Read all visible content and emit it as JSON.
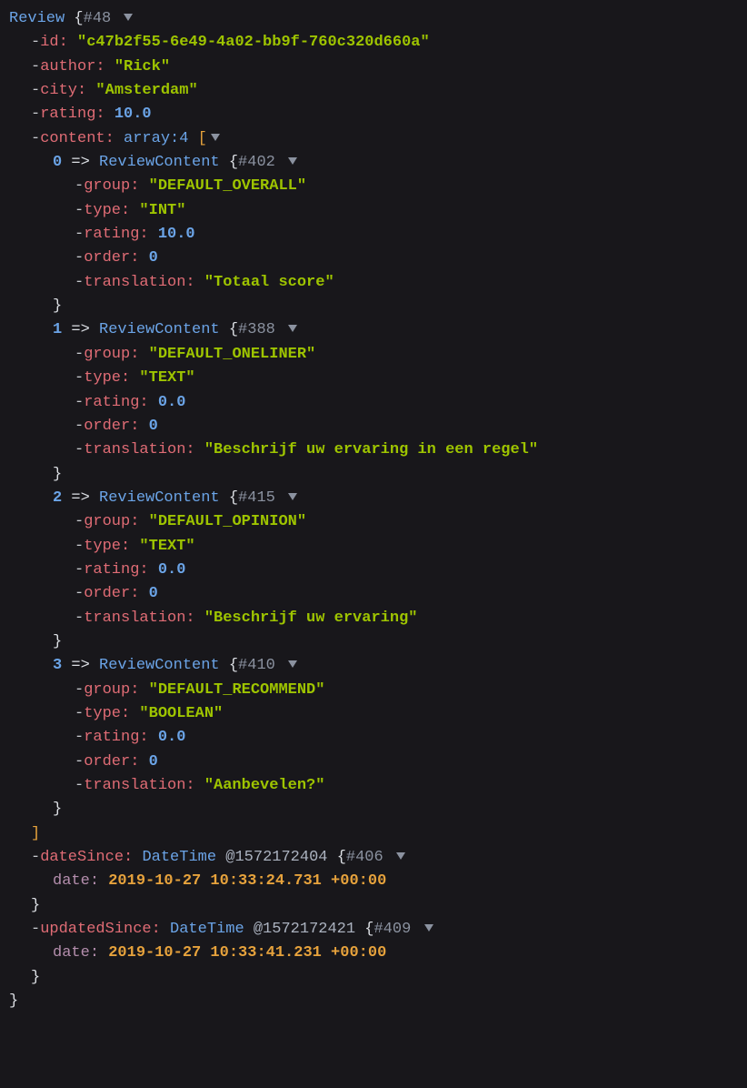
{
  "root": {
    "class": "Review",
    "hash": "#48",
    "props": {
      "id": "c47b2f55-6e49-4a02-bb9f-760c320d660a",
      "author": "Rick",
      "city": "Amsterdam",
      "rating": "10.0"
    },
    "contentLabel": "content",
    "contentType": "array:4",
    "content": [
      {
        "idx": "0",
        "class": "ReviewContent",
        "hash": "#402",
        "group": "DEFAULT_OVERALL",
        "type": "INT",
        "rating": "10.0",
        "order": "0",
        "translation": "Totaal score"
      },
      {
        "idx": "1",
        "class": "ReviewContent",
        "hash": "#388",
        "group": "DEFAULT_ONELINER",
        "type": "TEXT",
        "rating": "0.0",
        "order": "0",
        "translation": "Beschrijf uw ervaring in een regel"
      },
      {
        "idx": "2",
        "class": "ReviewContent",
        "hash": "#415",
        "group": "DEFAULT_OPINION",
        "type": "TEXT",
        "rating": "0.0",
        "order": "0",
        "translation": "Beschrijf uw ervaring"
      },
      {
        "idx": "3",
        "class": "ReviewContent",
        "hash": "#410",
        "group": "DEFAULT_RECOMMEND",
        "type": "BOOLEAN",
        "rating": "0.0",
        "order": "0",
        "translation": "Aanbevelen?"
      }
    ],
    "dateSince": {
      "key": "dateSince",
      "class": "DateTime",
      "ts": "@1572172404",
      "hash": "#406",
      "date": "2019-10-27 10:33:24.731 +00:00"
    },
    "updatedSince": {
      "key": "updatedSince",
      "class": "DateTime",
      "ts": "@1572172421",
      "hash": "#409",
      "date": "2019-10-27 10:33:41.231 +00:00"
    }
  },
  "keys": {
    "id": "id",
    "author": "author",
    "city": "city",
    "rating": "rating",
    "group": "group",
    "type": "type",
    "order": "order",
    "translation": "translation",
    "date": "date"
  }
}
